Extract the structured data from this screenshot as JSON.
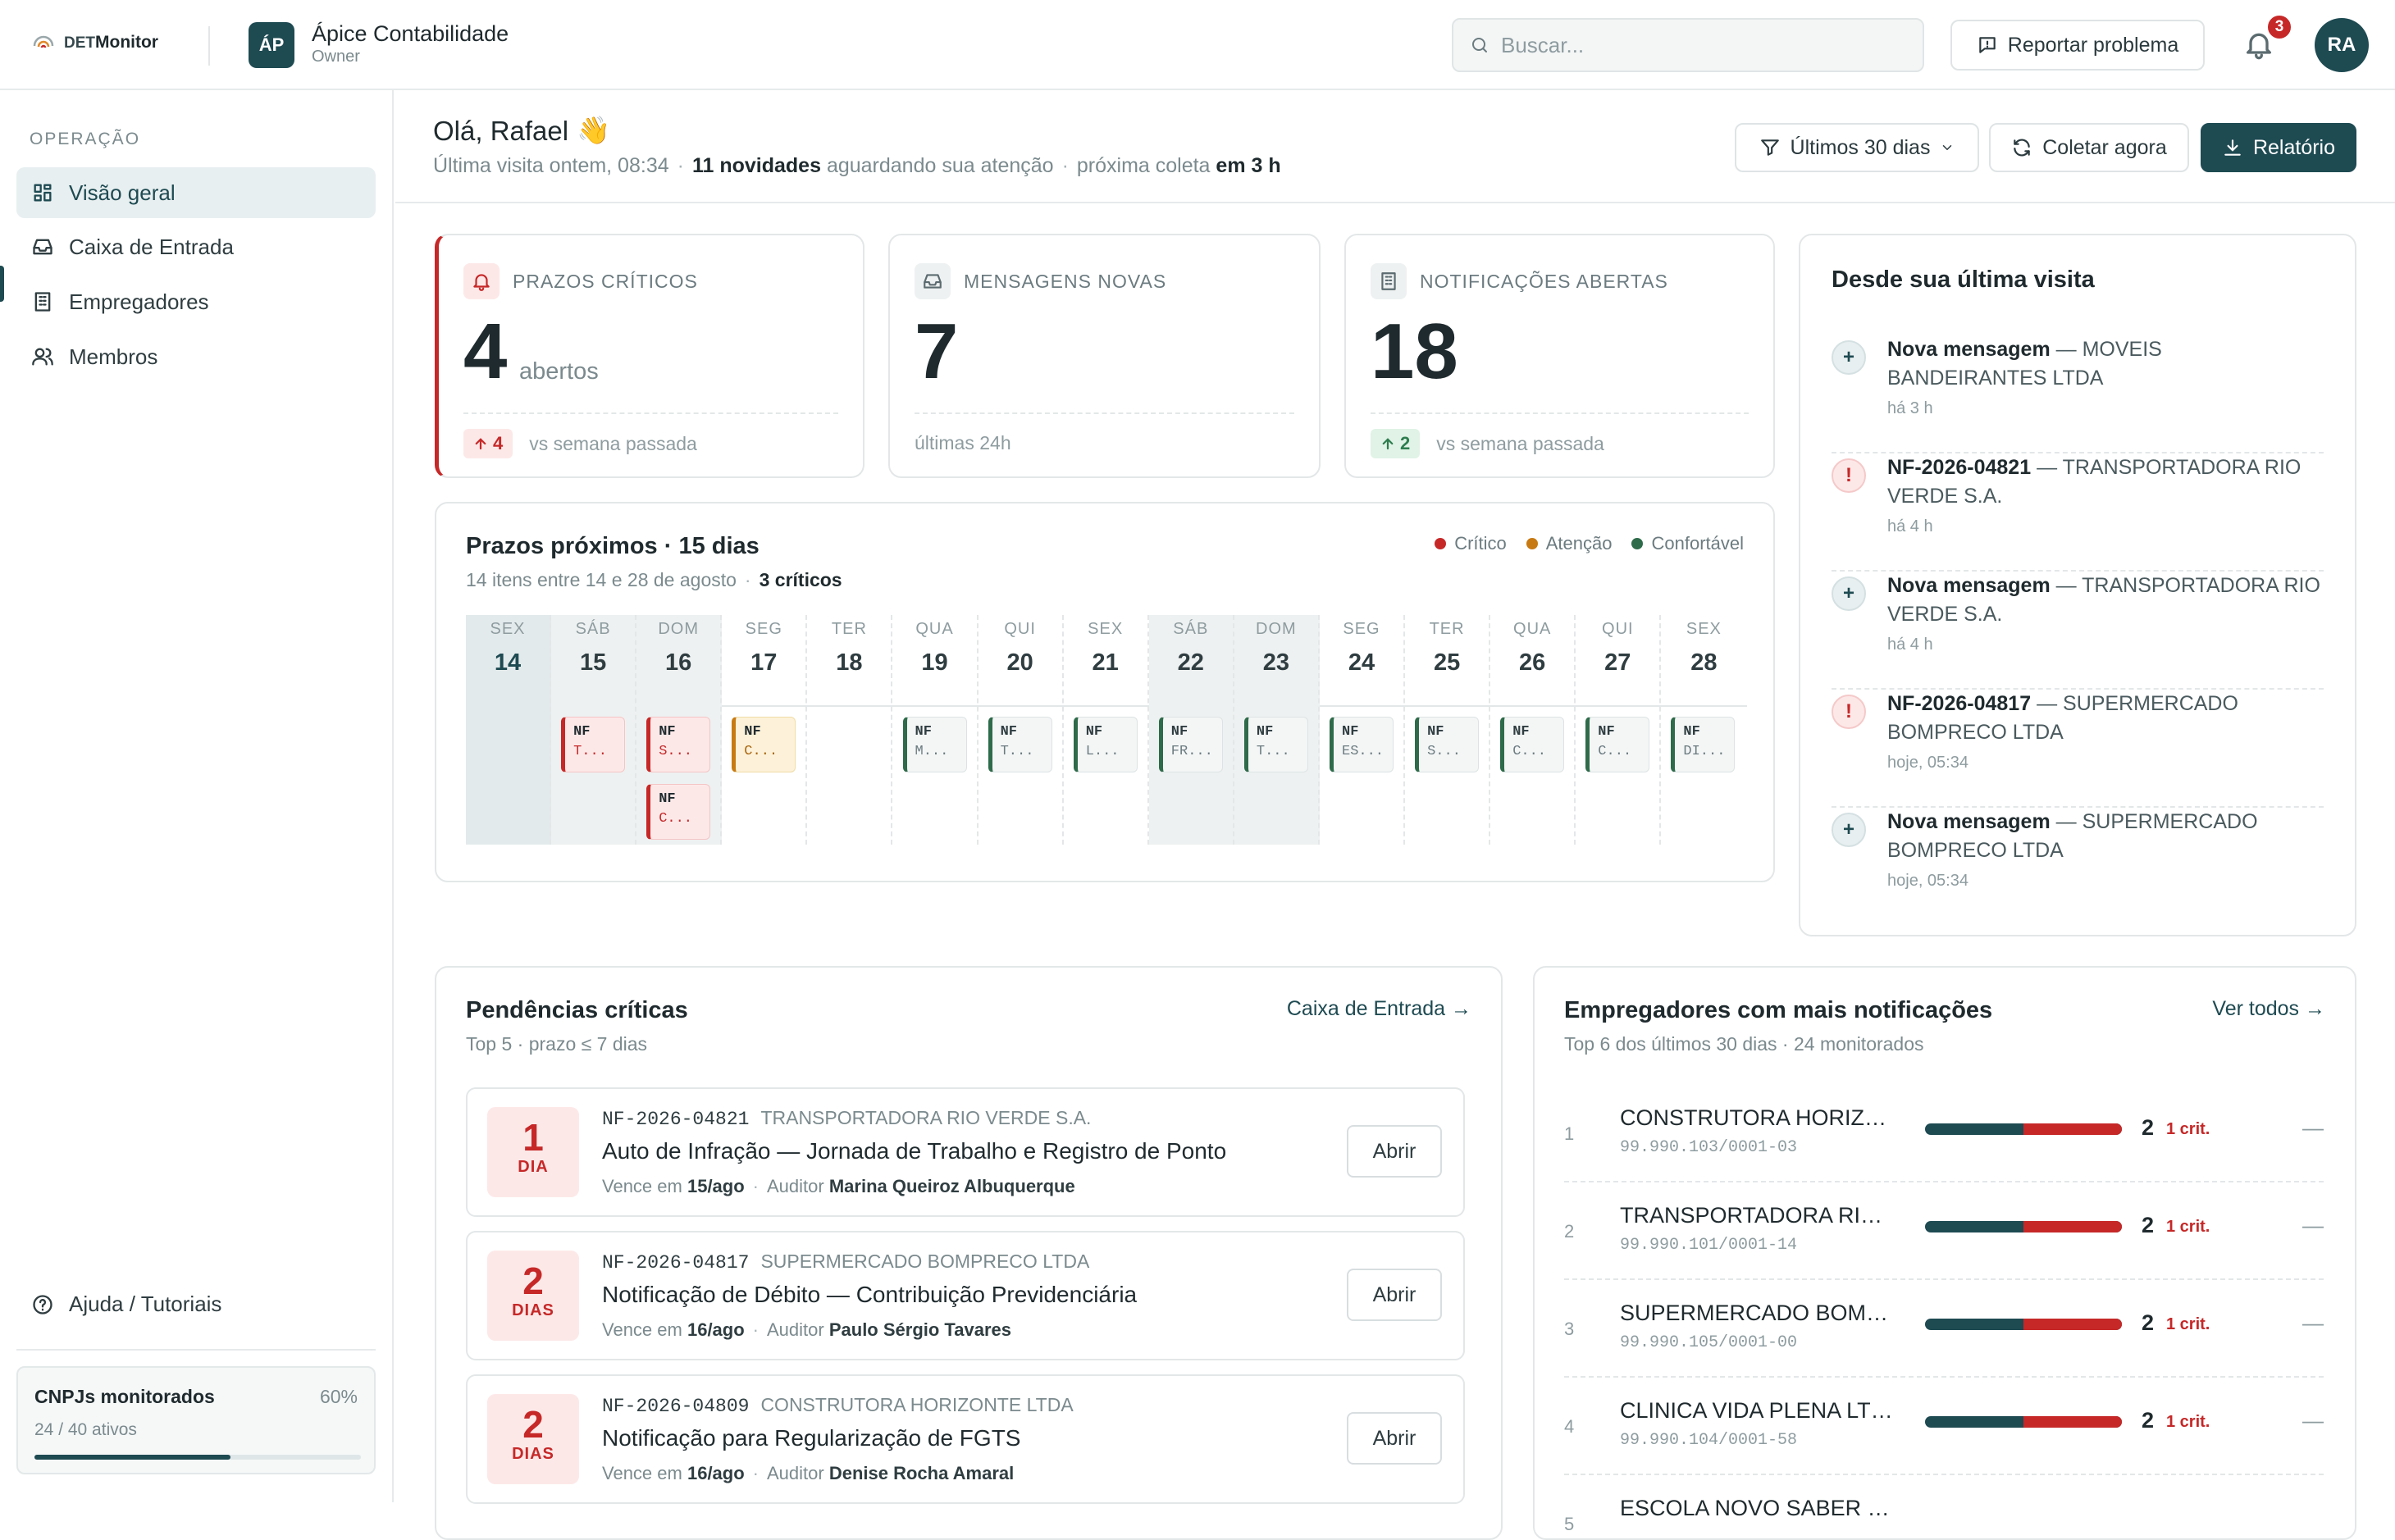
{
  "brand": {
    "prefix": "DET",
    "suffix": "Monitor"
  },
  "org": {
    "initials": "ÁP",
    "name": "Ápice Contabilidade",
    "role": "Owner"
  },
  "search": {
    "placeholder": "Buscar..."
  },
  "header": {
    "report_problem": "Reportar problema",
    "notification_count": "3",
    "user_initials": "RA"
  },
  "sidebar": {
    "heading": "OPERAÇÃO",
    "items": [
      {
        "label": "Visão geral",
        "icon": "dashboard-icon",
        "active": true
      },
      {
        "label": "Caixa de Entrada",
        "icon": "inbox-icon"
      },
      {
        "label": "Empregadores",
        "icon": "building-icon"
      },
      {
        "label": "Membros",
        "icon": "users-icon"
      }
    ],
    "help": "Ajuda / Tutoriais",
    "cnpj": {
      "title": "CNPJs monitorados",
      "percent": "60%",
      "count": "24 / 40 ativos",
      "fill_ratio": 0.6
    }
  },
  "greeting": {
    "hello": "Olá, Rafael",
    "emoji": "👋",
    "last_visit": "Última visita ontem, 08:34",
    "news_count": "11 novidades",
    "news_suffix": "aguardando sua atenção",
    "next_label": "próxima coleta",
    "next_value": "em 3 h"
  },
  "actions": {
    "filter": "Últimos 30 dias",
    "collect": "Coletar agora",
    "report": "Relatório"
  },
  "kpis": [
    {
      "label": "PRAZOS CRÍTICOS",
      "value": "4",
      "unit": "abertos",
      "delta": "4",
      "delta_dir": "up",
      "foot": "vs semana passada",
      "color": "#c62828"
    },
    {
      "label": "MENSAGENS NOVAS",
      "value": "7",
      "foot": "últimas 24h"
    },
    {
      "label": "NOTIFICAÇÕES ABERTAS",
      "value": "18",
      "delta": "2",
      "delta_dir": "up",
      "foot": "vs semana passada",
      "color": "#2e7d4f"
    }
  ],
  "since": {
    "title": "Desde sua última visita",
    "items": [
      {
        "type": "message",
        "bold": "Nova mensagem",
        "rest": " — MOVEIS BANDEIRANTES LTDA",
        "time": "há 3 h"
      },
      {
        "type": "alert",
        "bold": "NF-2026-04821",
        "rest": " — TRANSPORTADORA RIO VERDE S.A.",
        "time": "há 4 h"
      },
      {
        "type": "message",
        "bold": "Nova mensagem",
        "rest": " — TRANSPORTADORA RIO VERDE S.A.",
        "time": "há 4 h"
      },
      {
        "type": "alert",
        "bold": "NF-2026-04817",
        "rest": " — SUPERMERCADO BOMPRECO LTDA",
        "time": "hoje, 05:34"
      },
      {
        "type": "message",
        "bold": "Nova mensagem",
        "rest": " — SUPERMERCADO BOMPRECO LTDA",
        "time": "hoje, 05:34"
      }
    ]
  },
  "calendar": {
    "title": "Prazos próximos · 15 dias",
    "subtitle": "14 itens entre 14 e 28 de agosto",
    "crit_label": "3 críticos",
    "legend": [
      {
        "label": "Crítico",
        "color": "#c62828"
      },
      {
        "label": "Atenção",
        "color": "#c77a12"
      },
      {
        "label": "Confortável",
        "color": "#2e6b4a"
      }
    ],
    "days": [
      {
        "dow": "SEX",
        "day": "14",
        "kind": "today",
        "events": []
      },
      {
        "dow": "SÁB",
        "day": "15",
        "kind": "weekend",
        "events": [
          {
            "code": "NF",
            "name": "T...",
            "level": "crit"
          }
        ]
      },
      {
        "dow": "DOM",
        "day": "16",
        "kind": "weekend",
        "events": [
          {
            "code": "NF",
            "name": "S...",
            "level": "crit"
          },
          {
            "code": "NF",
            "name": "C...",
            "level": "crit"
          }
        ]
      },
      {
        "dow": "SEG",
        "day": "17",
        "kind": "",
        "events": [
          {
            "code": "NF",
            "name": "C...",
            "level": "att"
          }
        ]
      },
      {
        "dow": "TER",
        "day": "18",
        "kind": "",
        "events": []
      },
      {
        "dow": "QUA",
        "day": "19",
        "kind": "",
        "events": [
          {
            "code": "NF",
            "name": "M...",
            "level": "ok"
          }
        ]
      },
      {
        "dow": "QUI",
        "day": "20",
        "kind": "",
        "events": [
          {
            "code": "NF",
            "name": "T...",
            "level": "ok"
          }
        ]
      },
      {
        "dow": "SEX",
        "day": "21",
        "kind": "",
        "events": [
          {
            "code": "NF",
            "name": "L...",
            "level": "ok"
          }
        ]
      },
      {
        "dow": "SÁB",
        "day": "22",
        "kind": "weekend",
        "events": [
          {
            "code": "NF",
            "name": "FR...",
            "level": "ok"
          }
        ]
      },
      {
        "dow": "DOM",
        "day": "23",
        "kind": "weekend",
        "events": [
          {
            "code": "NF",
            "name": "T...",
            "level": "ok"
          }
        ]
      },
      {
        "dow": "SEG",
        "day": "24",
        "kind": "",
        "events": [
          {
            "code": "NF",
            "name": "ES...",
            "level": "ok"
          }
        ]
      },
      {
        "dow": "TER",
        "day": "25",
        "kind": "",
        "events": [
          {
            "code": "NF",
            "name": "S...",
            "level": "ok"
          }
        ]
      },
      {
        "dow": "QUA",
        "day": "26",
        "kind": "",
        "events": [
          {
            "code": "NF",
            "name": "C...",
            "level": "ok"
          }
        ]
      },
      {
        "dow": "QUI",
        "day": "27",
        "kind": "",
        "events": [
          {
            "code": "NF",
            "name": "C...",
            "level": "ok"
          }
        ]
      },
      {
        "dow": "SEX",
        "day": "28",
        "kind": "",
        "events": [
          {
            "code": "NF",
            "name": "DI...",
            "level": "ok"
          }
        ]
      }
    ]
  },
  "pending": {
    "title": "Pendências críticas",
    "subtitle": "Top 5 · prazo ≤ 7 dias",
    "link": "Caixa de Entrada →",
    "open_label": "Abrir",
    "due_prefix": "Vence em",
    "auditor_prefix": "Auditor",
    "items": [
      {
        "days": "1",
        "unit": "DIA",
        "id": "NF-2026-04821",
        "company": "TRANSPORTADORA RIO VERDE S.A.",
        "title": "Auto de Infração — Jornada de Trabalho e Registro de Ponto",
        "due": "15/ago",
        "auditor": "Marina Queiroz Albuquerque"
      },
      {
        "days": "2",
        "unit": "DIAS",
        "id": "NF-2026-04817",
        "company": "SUPERMERCADO BOMPRECO LTDA",
        "title": "Notificação de Débito — Contribuição Previdenciária",
        "due": "16/ago",
        "auditor": "Paulo Sérgio Tavares"
      },
      {
        "days": "2",
        "unit": "DIAS",
        "id": "NF-2026-04809",
        "company": "CONSTRUTORA HORIZONTE LTDA",
        "title": "Notificação para Regularização de FGTS",
        "due": "16/ago",
        "auditor": "Denise Rocha Amaral"
      }
    ]
  },
  "employers": {
    "title": "Empregadores com mais notificações",
    "subtitle": "Top 6 dos últimos 30 dias · 24 monitorados",
    "link": "Ver todos →",
    "items": [
      {
        "rank": "1",
        "name": "CONSTRUTORA HORIZO...",
        "cnpj": "99.990.103/0001-03",
        "count": "2",
        "crit": "1 crit.",
        "crit_ratio": 0.5,
        "trend": "—"
      },
      {
        "rank": "2",
        "name": "TRANSPORTADORA RIO ...",
        "cnpj": "99.990.101/0001-14",
        "count": "2",
        "crit": "1 crit.",
        "crit_ratio": 0.5,
        "trend": "—"
      },
      {
        "rank": "3",
        "name": "SUPERMERCADO BOMPR...",
        "cnpj": "99.990.105/0001-00",
        "count": "2",
        "crit": "1 crit.",
        "crit_ratio": 0.5,
        "trend": "—"
      },
      {
        "rank": "4",
        "name": "CLINICA VIDA PLENA LTDA",
        "cnpj": "99.990.104/0001-58",
        "count": "2",
        "crit": "1 crit.",
        "crit_ratio": 0.5,
        "trend": "—"
      },
      {
        "rank": "5",
        "name": "ESCOLA NOVO SABER LT...",
        "cnpj": "",
        "count": "",
        "crit": "",
        "crit_ratio": 0,
        "trend": ""
      }
    ]
  }
}
